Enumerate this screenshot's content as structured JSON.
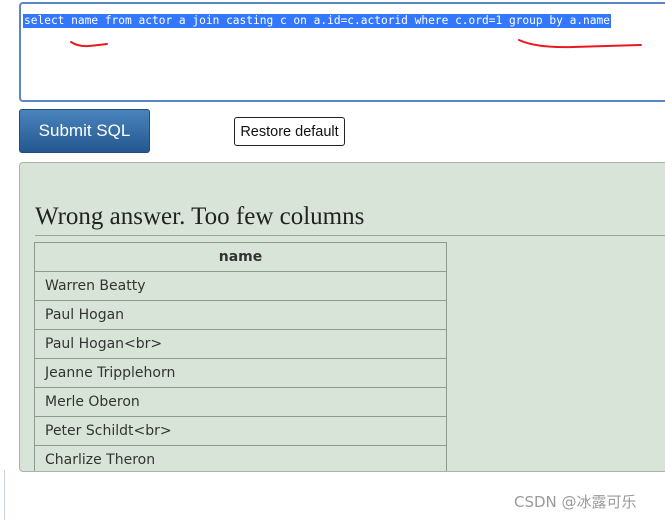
{
  "editor": {
    "sql": "select name from actor a join casting c on a.id=c.actorid where c.ord=1 group by a.name"
  },
  "buttons": {
    "submit_label": "Submit SQL",
    "restore_label": "Restore default"
  },
  "result": {
    "title": "Wrong answer. Too few columns",
    "columns": [
      "name"
    ],
    "rows": [
      "Warren Beatty",
      "Paul Hogan",
      "Paul Hogan<br>",
      "Jeanne Tripplehorn",
      "Merle Oberon",
      "Peter Schildt<br>",
      "Charlize Theron"
    ]
  },
  "watermark": "CSDN @冰露可乐",
  "colors": {
    "selection": "#3377ff",
    "panel_background": "#d9e4d9",
    "submit_button": "#2f6aa6",
    "annotation_ink": "#e8191f"
  }
}
